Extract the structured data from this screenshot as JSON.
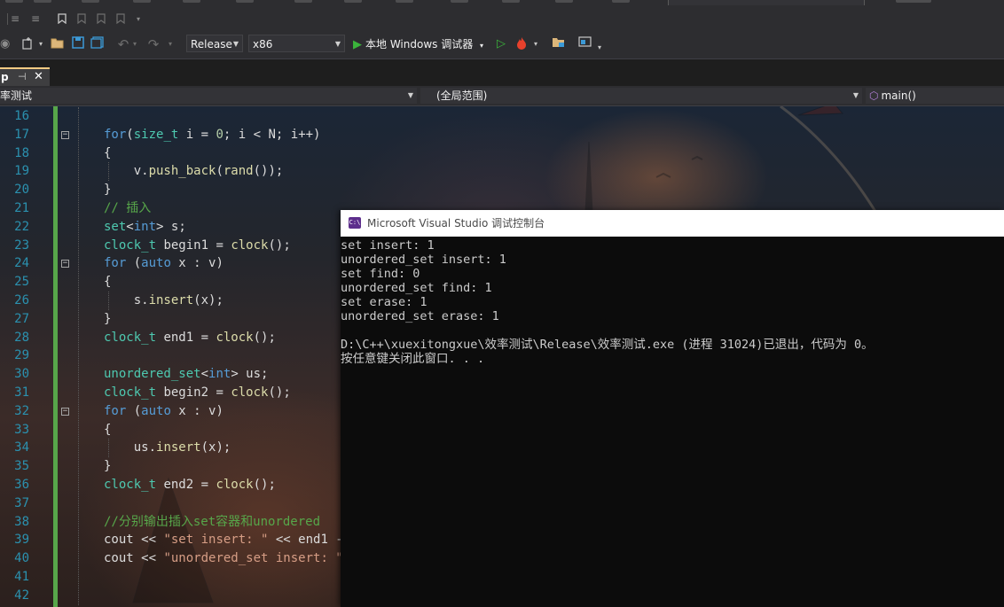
{
  "toolbar": {
    "configuration": "Release",
    "platform": "x86",
    "run_label": "本地 Windows 调试器"
  },
  "tabs": {
    "active_tab_partial": "p"
  },
  "navbar": {
    "project_scope": "率测试",
    "global_scope": "(全局范围)",
    "function_scope": "main()"
  },
  "editor": {
    "line_numbers": [
      "16",
      "17",
      "18",
      "19",
      "20",
      "21",
      "22",
      "23",
      "24",
      "25",
      "26",
      "27",
      "28",
      "29",
      "30",
      "31",
      "32",
      "33",
      "34",
      "35",
      "36",
      "37",
      "38",
      "39",
      "40",
      "41",
      "42"
    ],
    "lines": [
      [],
      [
        [
          "kw",
          "for"
        ],
        [
          "",
          "("
        ],
        [
          "ty",
          "size_t"
        ],
        [
          "",
          " i = "
        ],
        [
          "nu",
          "0"
        ],
        [
          "",
          "; i < N; i++)"
        ]
      ],
      [
        [
          "",
          "{"
        ]
      ],
      [
        [
          "",
          "    v."
        ],
        [
          "fn",
          "push_back"
        ],
        [
          "",
          "("
        ],
        [
          "fn",
          "rand"
        ],
        [
          "",
          "());"
        ]
      ],
      [
        [
          "",
          "}"
        ]
      ],
      [
        [
          "cm",
          "// 插入"
        ]
      ],
      [
        [
          "ty",
          "set"
        ],
        [
          "",
          "<"
        ],
        [
          "kw",
          "int"
        ],
        [
          "",
          "> s;"
        ]
      ],
      [
        [
          "ty",
          "clock_t"
        ],
        [
          "",
          " begin1 = "
        ],
        [
          "fn",
          "clock"
        ],
        [
          "",
          "();"
        ]
      ],
      [
        [
          "kw",
          "for"
        ],
        [
          "",
          " ("
        ],
        [
          "kw",
          "auto"
        ],
        [
          "",
          " x : v)"
        ]
      ],
      [
        [
          "",
          "{"
        ]
      ],
      [
        [
          "",
          "    s."
        ],
        [
          "fn",
          "insert"
        ],
        [
          "",
          "(x);"
        ]
      ],
      [
        [
          "",
          "}"
        ]
      ],
      [
        [
          "ty",
          "clock_t"
        ],
        [
          "",
          " end1 = "
        ],
        [
          "fn",
          "clock"
        ],
        [
          "",
          "();"
        ]
      ],
      [],
      [
        [
          "ty",
          "unordered_set"
        ],
        [
          "",
          "<"
        ],
        [
          "kw",
          "int"
        ],
        [
          "",
          "> us;"
        ]
      ],
      [
        [
          "ty",
          "clock_t"
        ],
        [
          "",
          " begin2 = "
        ],
        [
          "fn",
          "clock"
        ],
        [
          "",
          "();"
        ]
      ],
      [
        [
          "kw",
          "for"
        ],
        [
          "",
          " ("
        ],
        [
          "kw",
          "auto"
        ],
        [
          "",
          " x : v)"
        ]
      ],
      [
        [
          "",
          "{"
        ]
      ],
      [
        [
          "",
          "    us."
        ],
        [
          "fn",
          "insert"
        ],
        [
          "",
          "(x);"
        ]
      ],
      [
        [
          "",
          "}"
        ]
      ],
      [
        [
          "ty",
          "clock_t"
        ],
        [
          "",
          " end2 = "
        ],
        [
          "fn",
          "clock"
        ],
        [
          "",
          "();"
        ]
      ],
      [],
      [
        [
          "cm",
          "//分别输出插入set容器和unordered"
        ]
      ],
      [
        [
          "",
          "cout << "
        ],
        [
          "st",
          "\"set insert: \""
        ],
        [
          "",
          " << end1 -"
        ]
      ],
      [
        [
          "",
          "cout << "
        ],
        [
          "st",
          "\"unordered_set insert: \""
        ]
      ],
      [],
      []
    ]
  },
  "console": {
    "title": "Microsoft Visual Studio 调试控制台",
    "icon_text": "C:\\",
    "lines": [
      "set insert: 1",
      "unordered_set insert: 1",
      "set find: 0",
      "unordered_set find: 1",
      "set erase: 1",
      "unordered_set erase: 1",
      "",
      "D:\\C++\\xuexitongxue\\效率测试\\Release\\效率测试.exe (进程 31024)已退出，代码为 0。",
      "按任意键关闭此窗口. . ."
    ]
  },
  "colors": {
    "keyword": "#569cd6",
    "type": "#4ec9b0",
    "function": "#dcdcaa",
    "comment": "#57a64a",
    "string": "#d69d85",
    "line_number": "#2b91af",
    "change_bar": "#57a64a",
    "console_bg": "#0c0c0c"
  }
}
